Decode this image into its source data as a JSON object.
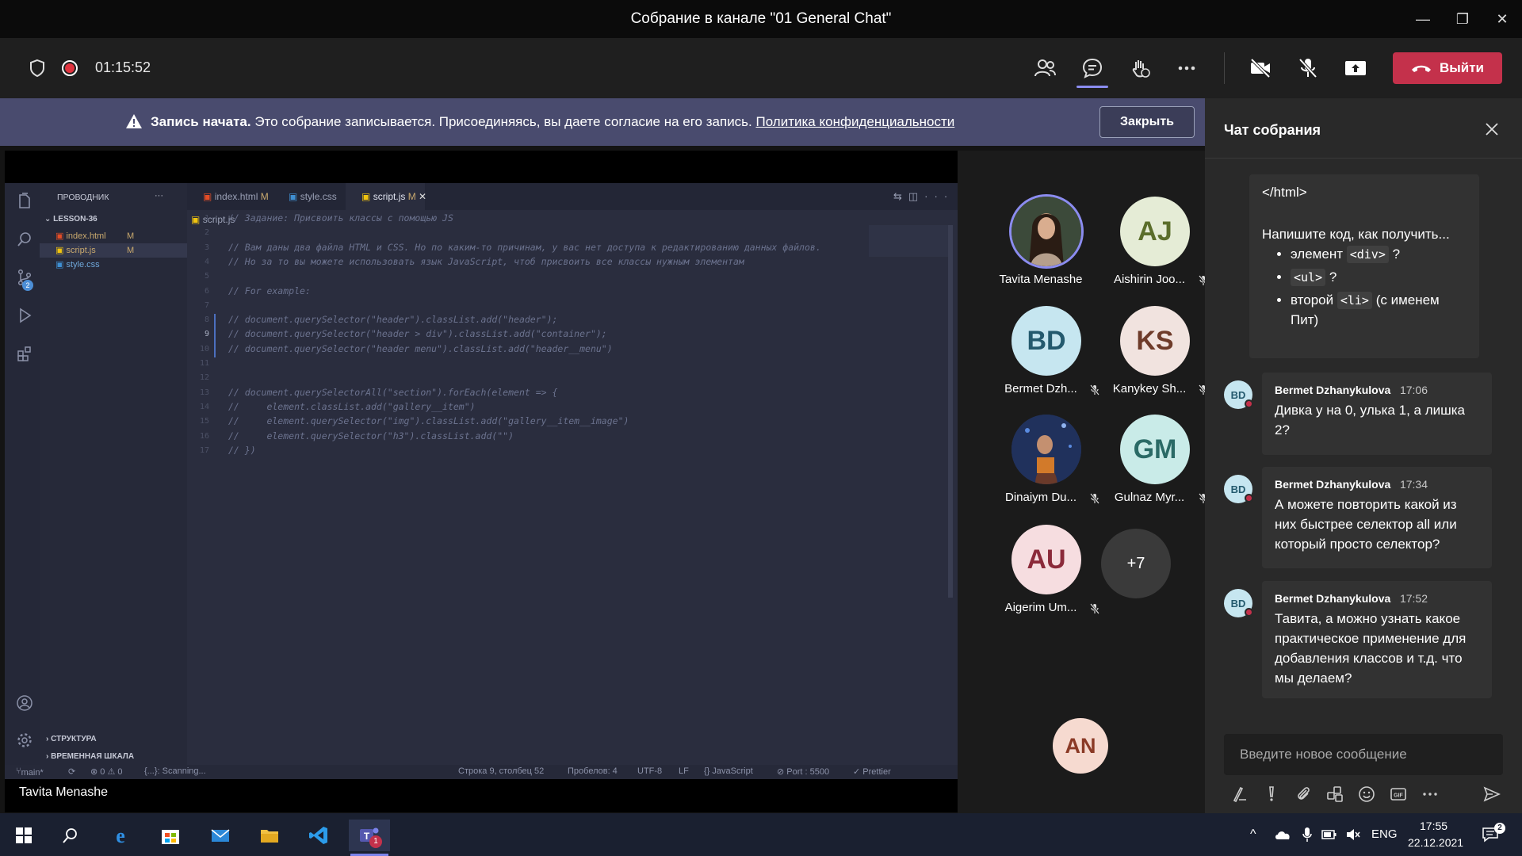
{
  "window": {
    "title": "Собрание в канале \"01 General Chat\"",
    "min": "—",
    "max": "❐",
    "close": "✕"
  },
  "toolbar": {
    "timer": "01:15:52",
    "leave_label": "Выйти"
  },
  "banner": {
    "bold": "Запись начата.",
    "text": " Это собрание записывается. Присоединяясь, вы даете согласие на его запись. ",
    "link": "Политика конфиденциальности",
    "close_label": "Закрыть"
  },
  "vscode": {
    "explorer_title": "ПРОВОДНИК",
    "folder": "LESSON-36",
    "files": [
      {
        "name": "index.html",
        "badge": "M",
        "color": "#e44d26"
      },
      {
        "name": "script.js",
        "badge": "M",
        "color": "#f1c40f"
      },
      {
        "name": "style.css",
        "badge": "",
        "color": "#3f8fd2"
      }
    ],
    "tabs": [
      {
        "name": "index.html",
        "badge": "M"
      },
      {
        "name": "style.css",
        "badge": ""
      },
      {
        "name": "script.js",
        "badge": "M"
      }
    ],
    "breadcrumb": "script.js",
    "outline": "СТРУКТУРА",
    "timeline": "ВРЕМЕННАЯ ШКАЛА",
    "code_lines": [
      "// Задание: Присвоить классы с помощью JS",
      "",
      "// Вам даны два файла HTML и CSS. Но по каким-то причинам, у вас нет доступа к редактированию данных файлов.",
      "// Но за то вы можете использовать язык JavaScript, чтоб присвоить все классы нужным элементам",
      "",
      "// For example:",
      "",
      "// document.querySelector(\"header\").classList.add(\"header\");",
      "// document.querySelector(\"header > div\").classList.add(\"container\");",
      "// document.querySelector(\"header menu\").classList.add(\"header__menu\")",
      "",
      "",
      "// document.querySelectorAll(\"section\").forEach(element => {",
      "//     element.classList.add(\"gallery__item\")",
      "//     element.querySelector(\"img\").classList.add(\"gallery__item__image\")",
      "//     element.querySelector(\"h3\").classList.add(\"\")",
      "// })"
    ],
    "status": {
      "branch": "main*",
      "problems": "⊗ 0 ⚠ 0",
      "scanning": "{...}: Scanning...",
      "position": "Строка 9, столбец 52",
      "spaces": "Пробелов: 4",
      "encoding": "UTF-8",
      "eol": "LF",
      "language": "{} JavaScript",
      "port": "⊘ Port : 5500",
      "prettier": "✓ Prettier"
    }
  },
  "presenter_name": "Tavita Menashe",
  "participants": [
    {
      "name": "Tavita Menashe",
      "initials": "",
      "muted": false,
      "bg": "#4a3a2e",
      "fg": "#fff"
    },
    {
      "name": "Aishirin Joo...",
      "initials": "AJ",
      "muted": true,
      "bg": "#e5ecd6",
      "fg": "#5b6e2b"
    },
    {
      "name": "Bermet Dzh...",
      "initials": "BD",
      "muted": true,
      "bg": "#c6e6f0",
      "fg": "#245a6e"
    },
    {
      "name": "Kanykey Sh...",
      "initials": "KS",
      "muted": true,
      "bg": "#f1e3df",
      "fg": "#6e3b2a"
    },
    {
      "name": "Dinaiym Du...",
      "initials": "",
      "muted": true,
      "bg": "#2f3a63",
      "fg": "#fff"
    },
    {
      "name": "Gulnaz Myr...",
      "initials": "GM",
      "muted": true,
      "bg": "#c9ebe8",
      "fg": "#2a6a66"
    },
    {
      "name": "Aigerim Um...",
      "initials": "AU",
      "muted": true,
      "bg": "#f6dde0",
      "fg": "#8b2a3a"
    }
  ],
  "more_participants": "+7",
  "self_initials": "AN",
  "chat": {
    "title": "Чат собрания",
    "first_bubble": {
      "code_end": "</html>",
      "question": "Напишите код, как получить...",
      "items": [
        {
          "pre": "элемент ",
          "code": "<div>",
          "post": " ?"
        },
        {
          "pre": "",
          "code": "<ul>",
          "post": " ?"
        },
        {
          "pre": "второй ",
          "code": "<li>",
          "post": " (с именем Пит)"
        }
      ]
    },
    "messages": [
      {
        "author": "Bermet Dzhanykulova",
        "time": "17:06",
        "text": "Дивка у на 0, улька 1, а лишка 2?",
        "initials": "BD"
      },
      {
        "author": "Bermet Dzhanykulova",
        "time": "17:34",
        "text": "А можете повторить какой из них быстрее селектор all или который просто селектор?",
        "initials": "BD"
      },
      {
        "author": "Bermet Dzhanykulova",
        "time": "17:52",
        "text": "Тавита, а можно узнать какое практическое применение для добавления классов и т.д. что мы делаем?",
        "initials": "BD"
      }
    ],
    "input_placeholder": "Введите новое сообщение"
  },
  "taskbar": {
    "lang": "ENG",
    "time": "17:55",
    "date": "22.12.2021",
    "teams_badge": "1"
  }
}
